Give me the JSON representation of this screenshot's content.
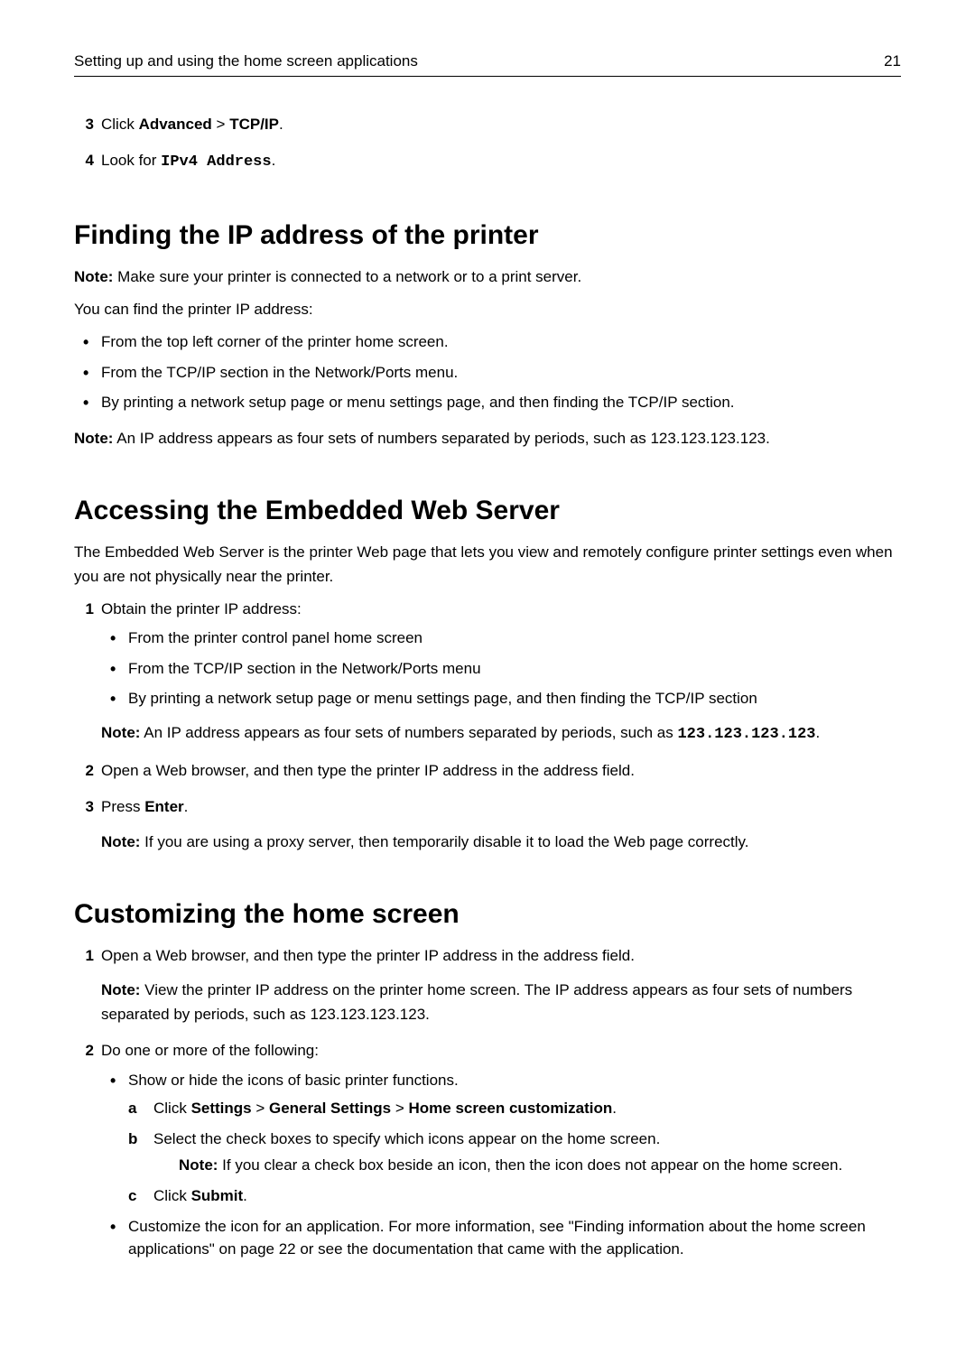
{
  "header": {
    "title": "Setting up and using the home screen applications",
    "page": "21"
  },
  "topSteps": {
    "step3_num": "3",
    "step3_pre": "Click ",
    "step3_b1": "Advanced",
    "step3_gt": " > ",
    "step3_b2": "TCP/IP",
    "step3_post": ".",
    "step4_num": "4",
    "step4_pre": "Look for ",
    "step4_mono": "IPv4 Address",
    "step4_post": "."
  },
  "sec1": {
    "heading": "Finding the IP address of the printer",
    "note_label": "Note:",
    "note_text": " Make sure your printer is connected to a network or to a print server.",
    "intro": "You can find the printer IP address:",
    "b1": "From the top left corner of the printer home screen.",
    "b2": "From the TCP/IP section in the Network/Ports menu.",
    "b3": "By printing a network setup page or menu settings page, and then finding the TCP/IP section.",
    "note2_label": "Note:",
    "note2_text": " An IP address appears as four sets of numbers separated by periods, such as 123.123.123.123."
  },
  "sec2": {
    "heading": "Accessing the Embedded Web Server",
    "intro": "The Embedded Web Server is the printer Web page that lets you view and remotely configure printer settings even when you are not physically near the printer.",
    "s1_num": "1",
    "s1_text": "Obtain the printer IP address:",
    "s1_b1": "From the printer control panel home screen",
    "s1_b2": "From the TCP/IP section in the Network/Ports menu",
    "s1_b3": "By printing a network setup page or menu settings page, and then finding the TCP/IP section",
    "s1_note_label": "Note:",
    "s1_note_text": " An IP address appears as four sets of numbers separated by periods, such as ",
    "s1_note_mono": "123.123.123.123",
    "s1_note_post": ".",
    "s2_num": "2",
    "s2_text": "Open a Web browser, and then type the printer IP address in the address field.",
    "s3_num": "3",
    "s3_pre": "Press ",
    "s3_bold": "Enter",
    "s3_post": ".",
    "s3_note_label": "Note:",
    "s3_note_text": " If you are using a proxy server, then temporarily disable it to load the Web page correctly."
  },
  "sec3": {
    "heading": "Customizing the home screen",
    "s1_num": "1",
    "s1_text": "Open a Web browser, and then type the printer IP address in the address field.",
    "s1_note_label": "Note:",
    "s1_note_text": " View the printer IP address on the printer home screen. The IP address appears as four sets of numbers separated by periods, such as 123.123.123.123.",
    "s2_num": "2",
    "s2_text": "Do one or more of the following:",
    "s2_b1": "Show or hide the icons of basic printer functions.",
    "s2_b1_a_label": "a",
    "s2_b1_a_pre": "Click ",
    "s2_b1_a_b1": "Settings",
    "s2_b1_a_gt1": " > ",
    "s2_b1_a_b2": "General Settings",
    "s2_b1_a_gt2": " > ",
    "s2_b1_a_b3": "Home screen customization",
    "s2_b1_a_post": ".",
    "s2_b1_b_label": "b",
    "s2_b1_b_text": "Select the check boxes to specify which icons appear on the home screen.",
    "s2_b1_b_note_label": "Note:",
    "s2_b1_b_note_text": " If you clear a check box beside an icon, then the icon does not appear on the home screen.",
    "s2_b1_c_label": "c",
    "s2_b1_c_pre": "Click ",
    "s2_b1_c_bold": "Submit",
    "s2_b1_c_post": ".",
    "s2_b2": "Customize the icon for an application. For more information, see \"Finding information about the home screen applications\" on page 22 or see the documentation that came with the application."
  }
}
